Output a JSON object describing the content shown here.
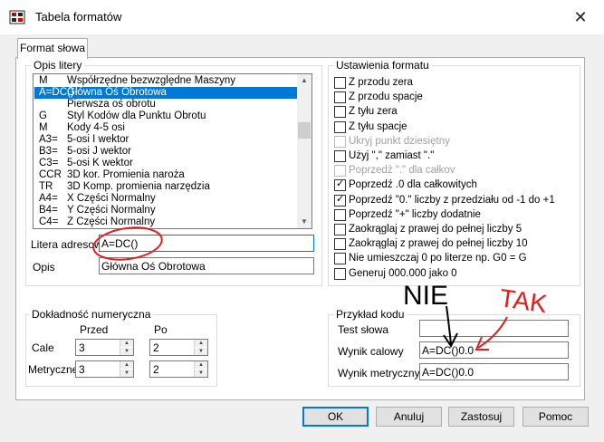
{
  "window": {
    "title": "Tabela formatów",
    "close_glyph": "✕",
    "icon": "app-icon"
  },
  "tab": {
    "label": "Format słowa"
  },
  "letter_desc": {
    "label": "Opis litery",
    "items": [
      {
        "code": "M",
        "desc": "Współrzędne bezwzględne Maszyny",
        "selected": false
      },
      {
        "code": "A=DC()",
        "desc": "Główna Oś Obrotowa",
        "selected": true
      },
      {
        "code": "",
        "desc": "Pierwsza oś obrotu",
        "selected": false
      },
      {
        "code": "G",
        "desc": "Styl Kodów dla Punktu Obrotu",
        "selected": false
      },
      {
        "code": "M",
        "desc": "Kody 4-5 osi",
        "selected": false
      },
      {
        "code": "A3=",
        "desc": "5-osi I wektor",
        "selected": false
      },
      {
        "code": "B3=",
        "desc": "5-osi J wektor",
        "selected": false
      },
      {
        "code": "C3=",
        "desc": "5-osi K wektor",
        "selected": false
      },
      {
        "code": "CCR",
        "desc": "3D kor. Promienia naroża",
        "selected": false
      },
      {
        "code": "TR",
        "desc": "3D Komp. promienia narzędzia",
        "selected": false
      },
      {
        "code": "A4=",
        "desc": "X Części Normalny",
        "selected": false
      },
      {
        "code": "B4=",
        "desc": "Y Części Normalny",
        "selected": false
      },
      {
        "code": "C4=",
        "desc": "Z Części Normalny",
        "selected": false
      }
    ],
    "address_label": "Litera adresowa",
    "address_value": "A=DC()",
    "desc_label": "Opis",
    "desc_value": "Główna Oś Obrotowa"
  },
  "format_settings": {
    "label": "Ustawienia formatu",
    "options": [
      {
        "label": "Z przodu zera",
        "checked": false,
        "disabled": false
      },
      {
        "label": "Z przodu spacje",
        "checked": false,
        "disabled": false
      },
      {
        "label": "Z tyłu zera",
        "checked": false,
        "disabled": false
      },
      {
        "label": "Z tyłu spacje",
        "checked": false,
        "disabled": false
      },
      {
        "label": "Ukryj punkt dziesiętny",
        "checked": false,
        "disabled": true
      },
      {
        "label": "Użyj \",\" zamiast \".\"",
        "checked": false,
        "disabled": false
      },
      {
        "label": "Poprzedź \".\" dla całkov",
        "checked": false,
        "disabled": true
      },
      {
        "label": "Poprzedź .0 dla całkowitych",
        "checked": true,
        "disabled": false
      },
      {
        "label": "Poprzedź \"0.\" liczby z przedziału od -1 do +1",
        "checked": true,
        "disabled": false
      },
      {
        "label": "Poprzedź \"+\" liczby dodatnie",
        "checked": false,
        "disabled": false
      },
      {
        "label": "Zaokrąglaj z prawej do pełnej liczby 5",
        "checked": false,
        "disabled": false
      },
      {
        "label": "Zaokrąglaj z prawej do pełnej liczby 10",
        "checked": false,
        "disabled": false
      },
      {
        "label": "Nie umieszczaj 0 po literze np. G0 = G",
        "checked": false,
        "disabled": false
      },
      {
        "label": "Generuj 000.000 jako 0",
        "checked": false,
        "disabled": false
      }
    ],
    "check_glyph": "✓"
  },
  "precision": {
    "label": "Dokładność numeryczna",
    "before_label": "Przed",
    "after_label": "Po",
    "rows": [
      {
        "label": "Cale",
        "before": "3",
        "after": "2"
      },
      {
        "label": "Metryczne",
        "before": "3",
        "after": "2"
      }
    ],
    "up_glyph": "▲",
    "down_glyph": "▼"
  },
  "example": {
    "label": "Przykład kodu",
    "test_label": "Test słowa",
    "test_value": "",
    "inch_label": "Wynik calowy",
    "inch_value": "A=DC()0.0",
    "metric_label": "Wynik metryczny",
    "metric_value": "A=DC()0.0"
  },
  "annotations": {
    "nie": "NIE",
    "tak": "TAK",
    "colors": {
      "red": "#e02020",
      "black": "#000000"
    }
  },
  "buttons": {
    "ok": "OK",
    "cancel": "Anuluj",
    "apply": "Zastosuj",
    "help": "Pomoc"
  },
  "colors": {
    "selection": "#0078d7",
    "button_face": "#e1e1e1"
  }
}
